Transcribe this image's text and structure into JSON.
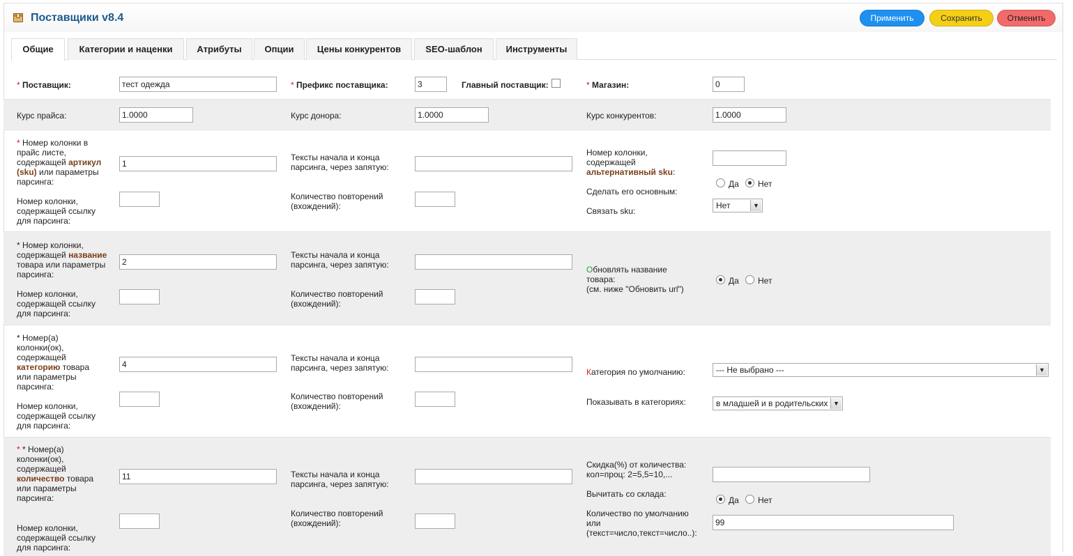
{
  "header": {
    "title": "Поставщики v8.4",
    "icon": "box-icon",
    "buttons": {
      "apply": "Применить",
      "save": "Сохранить",
      "cancel": "Отменить"
    },
    "colors": {
      "apply": "#1e90ef",
      "save": "#f5cf16",
      "cancel": "#f26a6a"
    }
  },
  "tabs": [
    {
      "label": "Общие",
      "active": true
    },
    {
      "label": "Категории и наценки"
    },
    {
      "label": "Атрибуты"
    },
    {
      "label": "Опции"
    },
    {
      "label": "Цены конкурентов"
    },
    {
      "label": "SEO-шаблон"
    },
    {
      "label": "Инструменты"
    }
  ],
  "row1": {
    "supplier": {
      "label": "Поставщик:",
      "value": "тест одежда"
    },
    "prefix": {
      "label": "Префикс поставщика:",
      "value": "3"
    },
    "main_supplier": {
      "label": "Главный поставщик:"
    },
    "store": {
      "label": "Магазин:",
      "value": "0"
    }
  },
  "row2": {
    "price_rate": {
      "label": "Курс прайса:",
      "value": "1.0000"
    },
    "donor_rate": {
      "label": "Курс донора:",
      "value": "1.0000"
    },
    "competitor_rate": {
      "label": "Курс конкурентов:",
      "value": "1.0000"
    }
  },
  "sku_row": {
    "col_label_pre": "Номер колонки в прайс листе, содержащей",
    "col_label_hl": "артикул (sku)",
    "col_label_post": "или параметры парсинга:",
    "col_value": "1",
    "link_label": "Номер колонки, содержащей ссылку для парсинга:",
    "link_value": "",
    "texts_label": "Тексты начала и конца парсинга, через запятую:",
    "texts_value": "",
    "repeat_label": "Количество повторений (вхождений):",
    "repeat_value": "",
    "alt_label_pre": "Номер колонки, содержащей",
    "alt_label_hl": "альтернативный sku",
    "alt_label_post": ":",
    "alt_value": "",
    "make_main_label": "Сделать его основным:",
    "yes": "Да",
    "no": "Нет",
    "link_sku_label": "Связать sku:",
    "link_sku_value": "Нет"
  },
  "name_row": {
    "col_label_pre": "* Номер колонки, содержащей",
    "col_label_hl": "название",
    "col_label_post": "товара или параметры парсинга:",
    "col_value": "2",
    "link_label": "Номер колонки, содержащей ссылку для парсинга:",
    "texts_label": "Тексты начала и конца парсинга, через запятую:",
    "repeat_label": "Количество повторений (вхождений):",
    "update_first": "О",
    "update_rest": "бновлять название товара:",
    "update_note": "(см. ниже \"Обновить url\")",
    "yes": "Да",
    "no": "Нет"
  },
  "category_row": {
    "col_label_pre": "* Номер(а) колонки(ок), содержащей",
    "col_label_hl": "категорию",
    "col_label_post": "товара или параметры парсинга:",
    "col_value": "4",
    "link_label": "Номер колонки, содержащей ссылку для парсинга:",
    "texts_label": "Тексты начала и конца парсинга, через запятую:",
    "repeat_label": "Количество повторений (вхождений):",
    "default_first": "К",
    "default_rest": "атегория по умолчанию:",
    "default_value": "--- Не выбрано ---",
    "show_label": "Показывать в категориях:",
    "show_value": "в младшей и в родительских"
  },
  "qty_row": {
    "col_label_pre": "* Номер(а) колонки(ок), содержащей",
    "col_label_hl": "количество",
    "col_label_post": "товара или параметры парсинга:",
    "col_value": "11",
    "link_label": "Номер колонки, содержащей ссылку для парсинга:",
    "texts_label": "Тексты начала и конца парсинга, через запятую:",
    "repeat_label": "Количество повторений (вхождений):",
    "discount_label": "Скидка(%) от количества: кол=проц: 2=5,5=10,...",
    "discount_value": "",
    "subtract_label": "Вычитать со склада:",
    "yes": "Да",
    "no": "Нет",
    "default_qty_label": "Количество по умолчанию или (текст=число,текст=число..):",
    "default_qty_value": "99"
  }
}
